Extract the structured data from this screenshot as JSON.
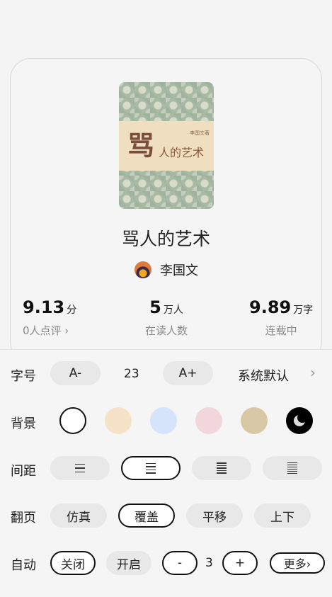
{
  "book": {
    "cover_big_char": "骂",
    "cover_small_text": "人的艺术",
    "cover_author": "李国文著",
    "title": "骂人的艺术",
    "author": "李国文"
  },
  "stats": [
    {
      "value": "9.13",
      "unit": "分",
      "label": "0人点评 ›"
    },
    {
      "value": "5",
      "unit": "万人",
      "label": "在读人数"
    },
    {
      "value": "9.89",
      "unit": "万字",
      "label": "连载中"
    }
  ],
  "settings": {
    "font_size": {
      "label": "字号",
      "decrease": "A-",
      "value": "23",
      "increase": "A+",
      "font_name": "系统默认"
    },
    "background": {
      "label": "背景",
      "colors": [
        "#ffffff",
        "#f6e2c6",
        "#d5e4fb",
        "#f1d6dc",
        "#d8c8a6",
        "#000000"
      ]
    },
    "spacing": {
      "label": "间距"
    },
    "page_turn": {
      "label": "翻页",
      "options": [
        "仿真",
        "覆盖",
        "平移",
        "上下"
      ],
      "selected": "覆盖"
    },
    "auto": {
      "label": "自动",
      "off": "关闭",
      "on": "开启",
      "minus": "-",
      "value": "3",
      "plus": "+",
      "more": "更多›"
    }
  }
}
